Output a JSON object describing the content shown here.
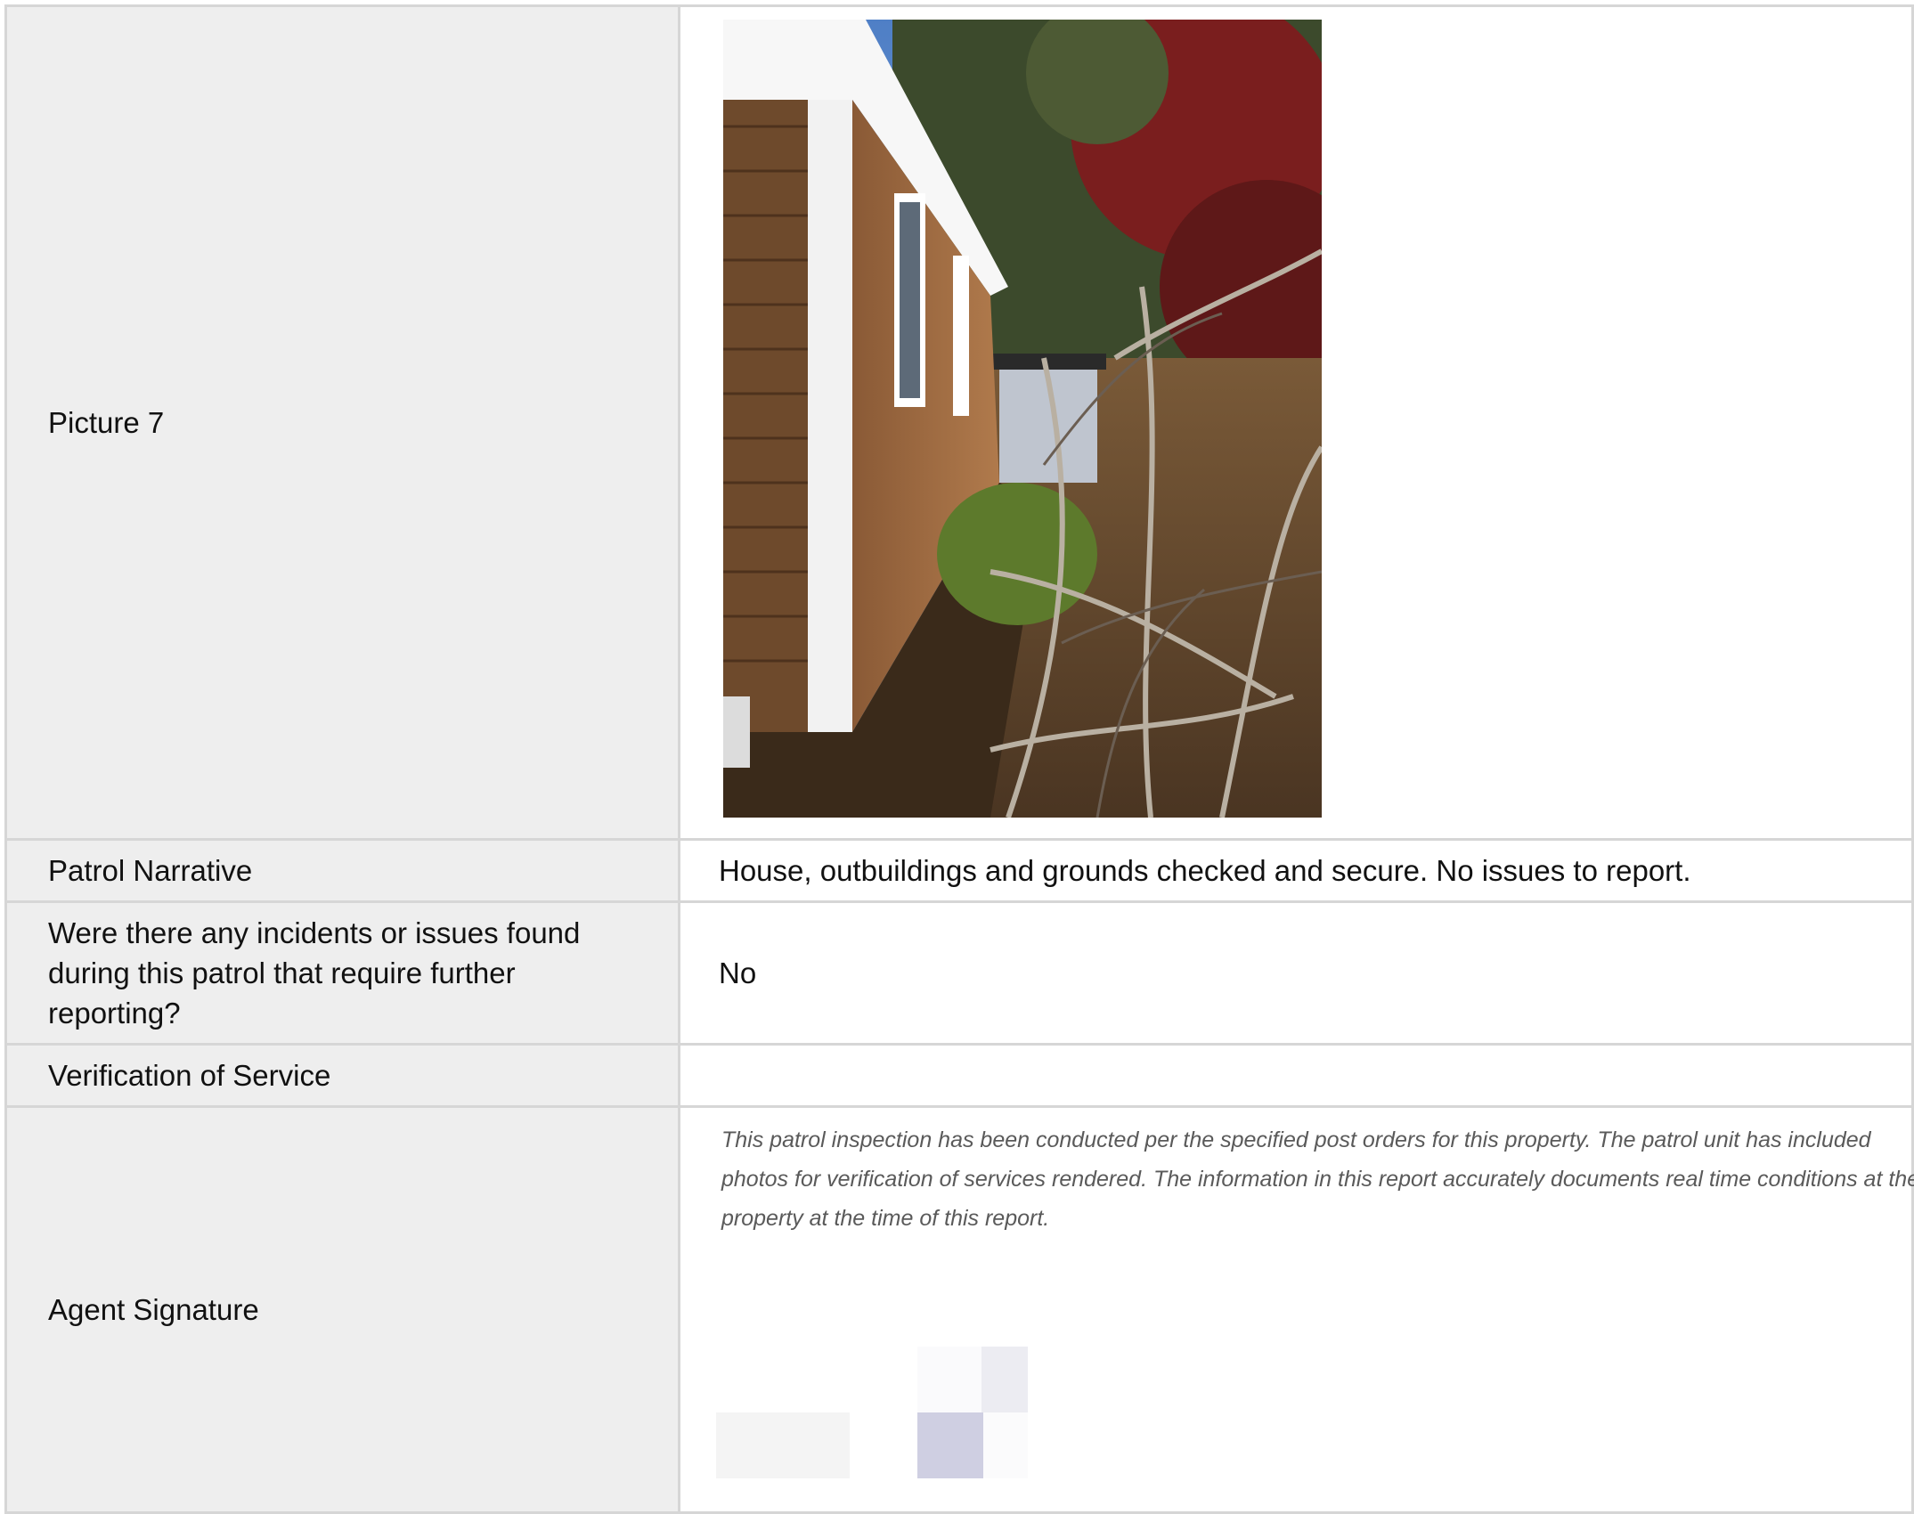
{
  "rows": {
    "picture": {
      "label": "Picture 7",
      "photo_icon": "photo-image"
    },
    "narrative": {
      "label": "Patrol Narrative",
      "value": "House, outbuildings and grounds checked and secure. No issues to report."
    },
    "incidents": {
      "label": "Were there any incidents or issues found during this patrol that require further reporting?",
      "value": "No"
    },
    "verification": {
      "label": "Verification of Service",
      "value": ""
    },
    "signature": {
      "label": "Agent Signature",
      "disclaimer": "This patrol inspection has been conducted per the specified post orders for this property. The patrol unit has included photos for verification of services rendered. The information in this report accurately documents real time conditions at the property at the time of this report.",
      "signature_icon": "signature-image"
    }
  },
  "colors": {
    "label_background": "#eeeeee",
    "border": "#d6d6d6",
    "disclaimer_text": "#5a5a5a"
  }
}
